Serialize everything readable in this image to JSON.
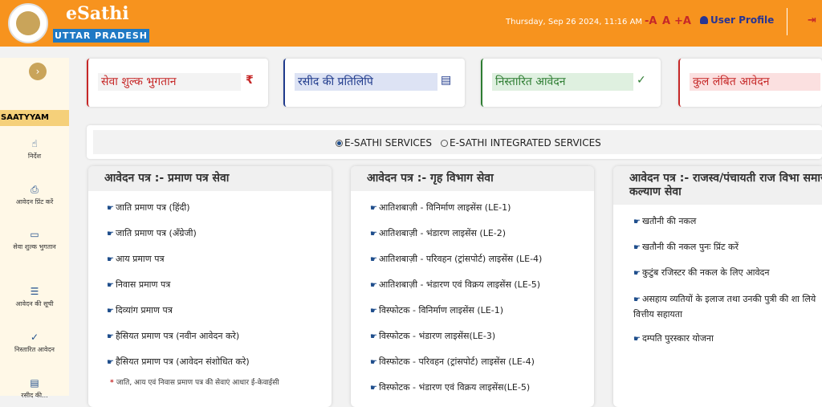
{
  "header": {
    "brand": "eSathi",
    "state": "UTTAR PRADESH",
    "datetime": "Thursday, Sep 26 2024, 11:16 AM",
    "font_decrease": "-A",
    "font_normal": "A",
    "font_increase": "+A",
    "user_profile": "User Profile",
    "logout_icon": "logout-icon"
  },
  "sidebar": {
    "toggle": "›",
    "title": "SAATYYAM",
    "items": [
      {
        "label": "निर्देश",
        "icon": "hand-pointer-icon"
      },
      {
        "label": "आवेदन प्रिंट करें",
        "icon": "printer-icon"
      },
      {
        "label": "सेवा शुल्क भुगतान",
        "icon": "credit-card-icon"
      },
      {
        "label": "आवेदन की सूची",
        "icon": "list-icon"
      },
      {
        "label": "निस्तारित आवेदन",
        "icon": "check-icon"
      },
      {
        "label": "रसीद की...",
        "icon": "receipt-icon"
      }
    ]
  },
  "cards": [
    {
      "label": "सेवा शुल्क भुगतान",
      "icon": "₹",
      "color": "#c62828",
      "bg": "#f3f3f3"
    },
    {
      "label": "रसीद की प्रतिलिपि",
      "icon": "▤",
      "color": "#1f3a8c",
      "bg": "#dde3f4"
    },
    {
      "label": "निस्तारित आवेदन",
      "icon": "✓",
      "color": "#2e7d32",
      "bg": "#dff0e0"
    },
    {
      "label": "कुल लंबित आवेदन",
      "icon": "",
      "color": "#c62828",
      "bg": "#fbe0e0"
    }
  ],
  "services": {
    "option1": "E-SATHI SERVICES",
    "option2": "E-SATHI INTEGRATED SERVICES",
    "selected": "option1"
  },
  "panels": [
    {
      "title": "आवेदन पत्र :-  प्रमाण पत्र सेवा",
      "links": [
        "जाति प्रमाण पत्र (हिंदी)",
        "जाति प्रमाण पत्र (अँग्रेजी)",
        "आय प्रमाण पत्र",
        "निवास प्रमाण पत्र",
        "दिव्यांग प्रमाण पत्र",
        "हैसियत प्रमाण पत्र (नवीन आवेदन करे)",
        "हैसियत प्रमाण पत्र (आवेदन संशोधित करे)"
      ],
      "note": "जाति, आय एवं निवास प्रमाण पत्र की सेवाएं आधार ई-केवाईसी"
    },
    {
      "title": "आवेदन पत्र :-  गृह विभाग सेवा",
      "links": [
        "आतिशबाज़ी - विनिर्माण लाइसेंस (LE-1)",
        "आतिशबाज़ी - भंडारण लाइसेंस (LE-2)",
        "आतिशबाज़ी - परिवहन (ट्रांसपोर्ट) लाइसेंस (LE-4)",
        "आतिशबाज़ी - भंडारण एवं विक्रय लाइसेंस (LE-5)",
        "विस्फोटक - विनिर्माण लाइसेंस (LE-1)",
        "विस्फोटक - भंडारण लाइसेंस(LE-3)",
        "विस्फोटक - परिवहन (ट्रांसपोर्ट) लाइसेंस (LE-4)",
        "विस्फोटक - भंडारण एवं विक्रय लाइसेंस(LE-5)"
      ]
    },
    {
      "title": "आवेदन पत्र :-  राजस्व/पंचायती राज विभा समाज कल्याण सेवा",
      "links": [
        "खतौनी की नकल",
        "खतौनी की नकल पुनः प्रिंट करें",
        "कुटुंब रजिस्टर की नकल के लिए आवेदन",
        "असहाय व्यतियों के इलाज तथा उनकी पुत्री की शा लिये वित्तीय सहायता",
        "दम्पति पुरस्कार योजना"
      ]
    }
  ]
}
